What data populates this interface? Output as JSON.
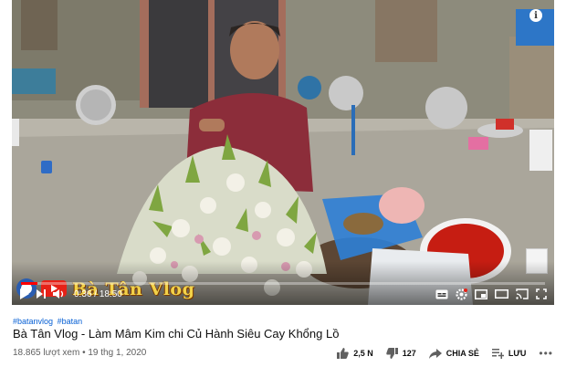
{
  "player": {
    "watermark_text": "Bà Tân Vlog",
    "current_time": "0:36",
    "duration": "18:50",
    "progress_fraction": 0.032,
    "accent_color": "#ff0000",
    "icons": [
      "info-icon",
      "play-icon",
      "next-icon",
      "volume-icon",
      "subtitles-icon",
      "settings-icon",
      "miniplayer-icon",
      "theater-icon",
      "cast-icon",
      "fullscreen-icon"
    ]
  },
  "video": {
    "hashtags": [
      "#batanvlog",
      "#batan"
    ],
    "title": "Bà Tân Vlog - Làm Mâm Kim chi Củ Hành Siêu Cay Khổng Lồ",
    "views": "18.865 lượt xem",
    "separator": "•",
    "date": "19 thg 1, 2020"
  },
  "actions": {
    "like_count": "2,5 N",
    "dislike_count": "127",
    "share_label": "CHIA SẺ",
    "save_label": "LƯU",
    "more_label": "•••"
  },
  "colors": {
    "link": "#065fd4",
    "text": "#0f0f0f",
    "muted": "#606060"
  }
}
